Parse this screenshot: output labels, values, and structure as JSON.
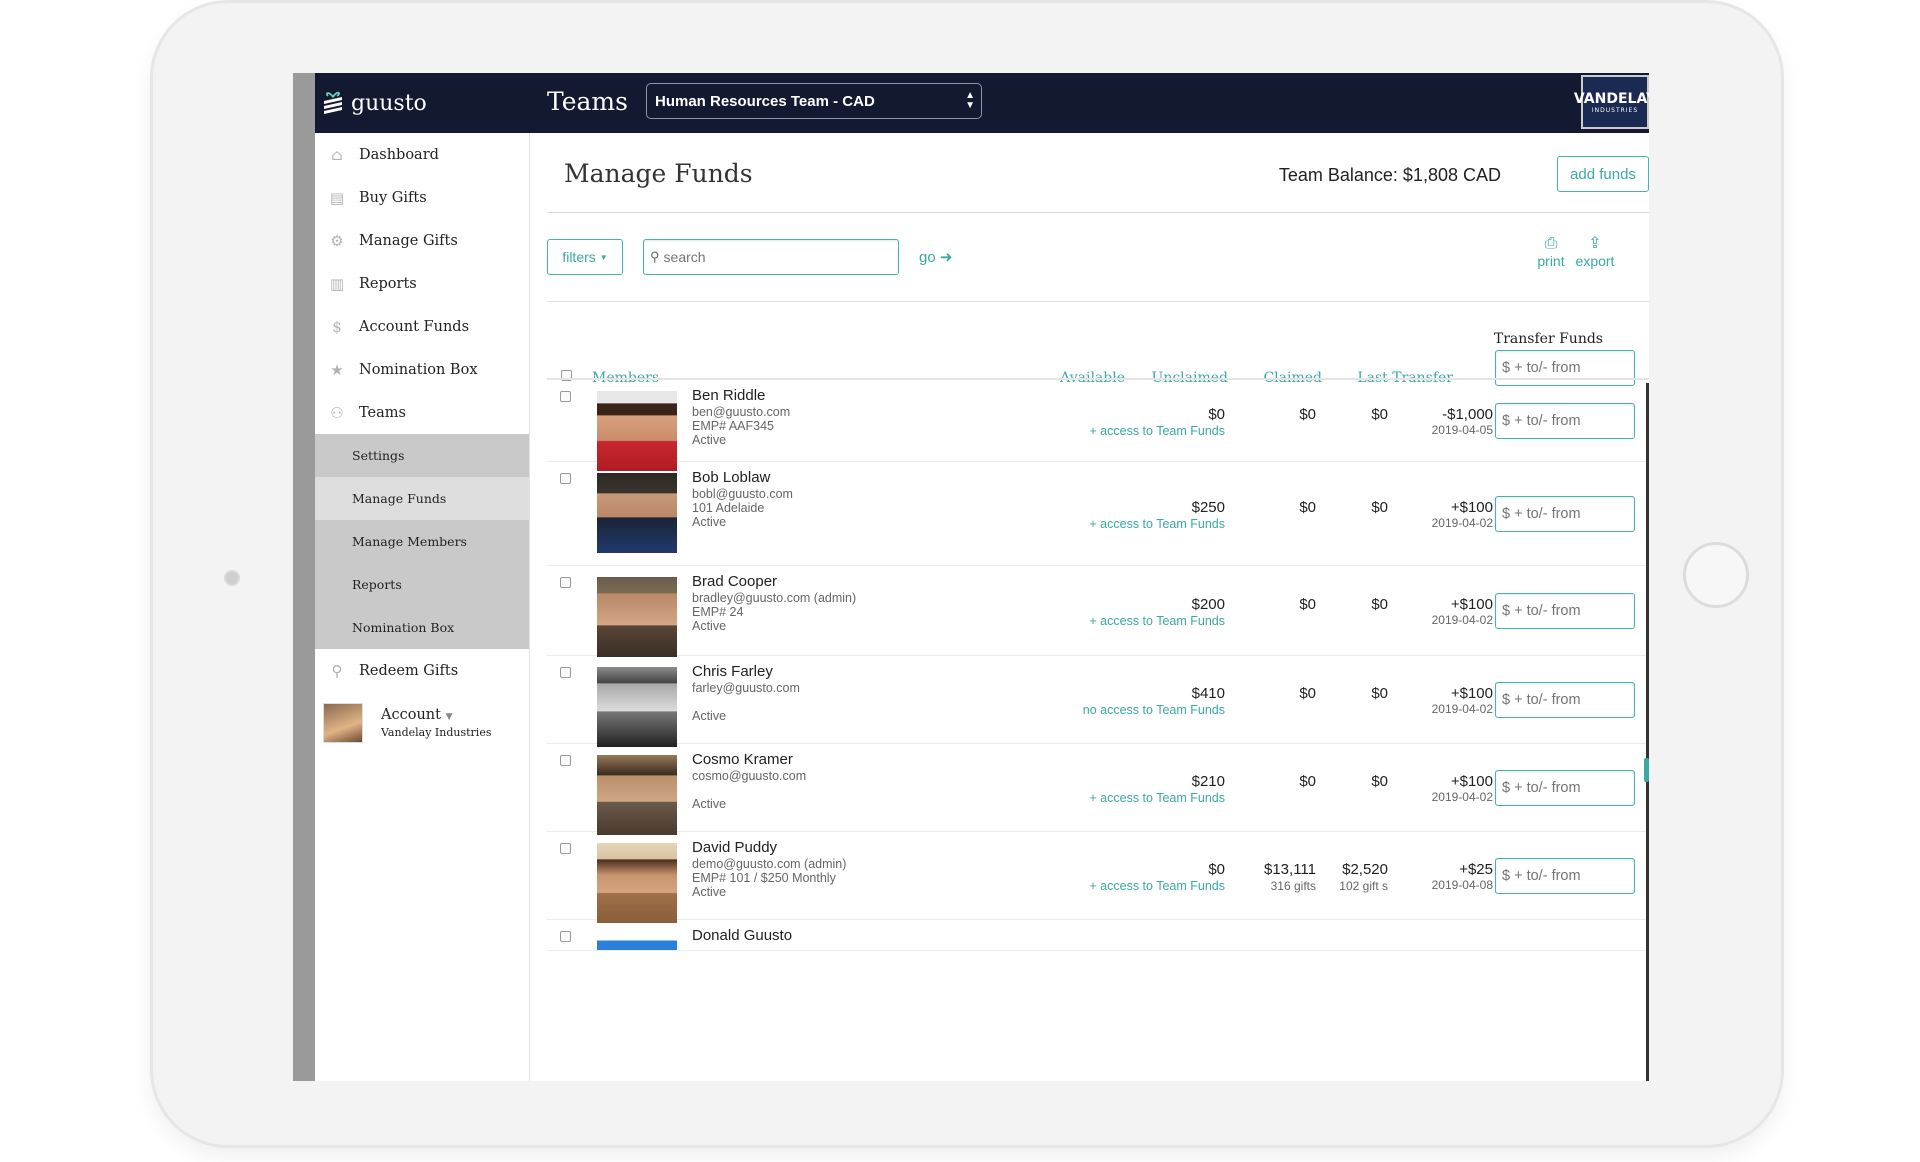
{
  "topbar": {
    "logo_text": "guusto",
    "title": "Teams",
    "team_selected": "Human Resources Team - CAD",
    "brand_badge": "VANDELAY",
    "brand_badge_sub": "INDUSTRIES"
  },
  "sidebar": {
    "items": [
      {
        "label": "Dashboard",
        "icon": "home-icon",
        "glyph": "⌂"
      },
      {
        "label": "Buy Gifts",
        "icon": "gift-icon",
        "glyph": "▤"
      },
      {
        "label": "Manage Gifts",
        "icon": "gear-icon",
        "glyph": "⚙"
      },
      {
        "label": "Reports",
        "icon": "bar-chart-icon",
        "glyph": "▥"
      },
      {
        "label": "Account Funds",
        "icon": "dollar-icon",
        "glyph": "$"
      },
      {
        "label": "Nomination Box",
        "icon": "star-icon",
        "glyph": "★"
      },
      {
        "label": "Teams",
        "icon": "people-icon",
        "glyph": "⚇"
      }
    ],
    "subitems": [
      "Settings",
      "Manage Funds",
      "Manage Members",
      "Reports",
      "Nomination Box"
    ],
    "redeem": {
      "label": "Redeem Gifts",
      "icon": "redeem-icon",
      "glyph": "⚲"
    },
    "account": {
      "label": "Account",
      "company": "Vandelay Industries"
    }
  },
  "main": {
    "title": "Manage Funds",
    "balance": "Team Balance: $1,808 CAD",
    "add_funds": "add funds",
    "filters": "filters",
    "search_placeholder": "search",
    "go": "go",
    "print": "print",
    "export": "export"
  },
  "table": {
    "headers": {
      "members": "Members",
      "available": "Available",
      "unclaimed": "Unclaimed",
      "claimed": "Claimed",
      "last_transfer": "Last Transfer",
      "transfer_funds": "Transfer Funds"
    },
    "transfer_placeholder": "$ + to/- from",
    "rows": [
      {
        "name": "Ben Riddle",
        "email": "ben@guusto.com",
        "extra": "EMP# AAF345",
        "status": "Active",
        "available": "$0",
        "access": "+ access to Team Funds",
        "unclaimed": "$0",
        "unclaimed_sub": "",
        "claimed": "$0",
        "claimed_sub": "",
        "last_amount": "-$1,000",
        "last_date": "2019-04-05"
      },
      {
        "name": "Bob Loblaw",
        "email": "bobl@guusto.com",
        "extra": "101 Adelaide",
        "status": "Active",
        "available": "$250",
        "access": "+ access to Team Funds",
        "unclaimed": "$0",
        "unclaimed_sub": "",
        "claimed": "$0",
        "claimed_sub": "",
        "last_amount": "+$100",
        "last_date": "2019-04-02"
      },
      {
        "name": "Brad Cooper",
        "email": "bradley@guusto.com (admin)",
        "extra": "EMP# 24",
        "status": "Active",
        "available": "$200",
        "access": "+ access to Team Funds",
        "unclaimed": "$0",
        "unclaimed_sub": "",
        "claimed": "$0",
        "claimed_sub": "",
        "last_amount": "+$100",
        "last_date": "2019-04-02"
      },
      {
        "name": "Chris Farley",
        "email": "farley@guusto.com",
        "extra": "",
        "status": "Active",
        "available": "$410",
        "access": "no access to Team Funds",
        "unclaimed": "$0",
        "unclaimed_sub": "",
        "claimed": "$0",
        "claimed_sub": "",
        "last_amount": "+$100",
        "last_date": "2019-04-02"
      },
      {
        "name": "Cosmo Kramer",
        "email": "cosmo@guusto.com",
        "extra": "",
        "status": "Active",
        "available": "$210",
        "access": "+ access to Team Funds",
        "unclaimed": "$0",
        "unclaimed_sub": "",
        "claimed": "$0",
        "claimed_sub": "",
        "last_amount": "+$100",
        "last_date": "2019-04-02"
      },
      {
        "name": "David Puddy",
        "email": "demo@guusto.com (admin)",
        "extra": "EMP# 101 / $250 Monthly",
        "status": "Active",
        "available": "$0",
        "access": "+ access to Team Funds",
        "unclaimed": "$13,111",
        "unclaimed_sub": "316 gifts",
        "claimed": "$2,520",
        "claimed_sub": "102 gift s",
        "last_amount": "+$25",
        "last_date": "2019-04-08"
      },
      {
        "name": "Donald Guusto",
        "email": "",
        "extra": "",
        "status": "",
        "available": "",
        "access": "",
        "unclaimed": "",
        "unclaimed_sub": "",
        "claimed": "",
        "claimed_sub": "",
        "last_amount": "",
        "last_date": ""
      }
    ]
  },
  "colors": {
    "accent": "#3aa9a3",
    "topbar": "#131930",
    "subnav": "#c9c9c9"
  }
}
